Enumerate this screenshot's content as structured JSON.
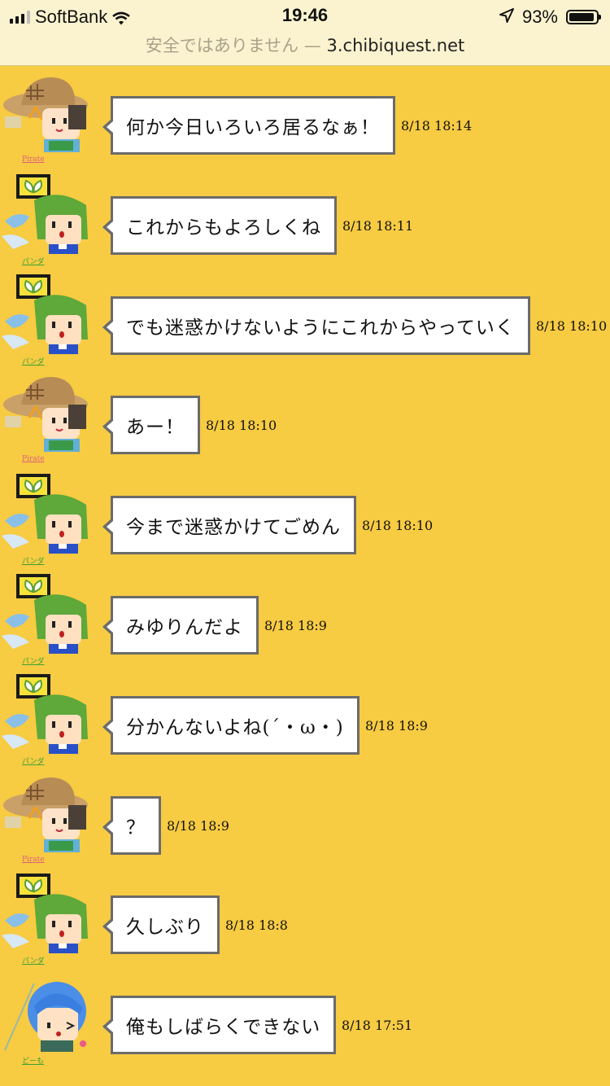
{
  "status_bar": {
    "carrier": "SoftBank",
    "time": "19:46",
    "battery_percent_text": "93%",
    "battery_level": 0.93,
    "url_warning": "安全ではありません —",
    "url_host": "3.chibiquest.net"
  },
  "colors": {
    "background": "#f7cb42",
    "bubble_border": "#6b6b6b",
    "name_pirate": "#e0607a",
    "name_panda": "#3aa335",
    "name_dome": "#3aa335"
  },
  "messages": [
    {
      "avatar": "straw-hat-character-icon",
      "text": "何か今日いろいろ居るなぁ！",
      "time": "8/18 18:14",
      "name": "Pirate"
    },
    {
      "avatar": "green-hair-character-icon",
      "text": "これからもよろしくね",
      "time": "8/18 18:11",
      "name": "パンダ"
    },
    {
      "avatar": "green-hair-character-icon",
      "text": "でも迷惑かけないようにこれからやっていく",
      "time": "8/18 18:10",
      "name": "パンダ"
    },
    {
      "avatar": "straw-hat-character-icon",
      "text": "あー！",
      "time": "8/18 18:10",
      "name": "Pirate"
    },
    {
      "avatar": "green-hair-character-icon",
      "text": "今まで迷惑かけてごめん",
      "time": "8/18 18:10",
      "name": "パンダ"
    },
    {
      "avatar": "green-hair-character-icon",
      "text": "みゆりんだよ",
      "time": "8/18 18:9",
      "name": "パンダ"
    },
    {
      "avatar": "green-hair-character-icon",
      "text": "分かんないよね(´・ω・)",
      "time": "8/18 18:9",
      "name": "パンダ"
    },
    {
      "avatar": "straw-hat-character-icon",
      "text": "？",
      "time": "8/18 18:9",
      "name": "Pirate"
    },
    {
      "avatar": "green-hair-character-icon",
      "text": "久しぶり",
      "time": "8/18 18:8",
      "name": "パンダ"
    },
    {
      "avatar": "blue-hair-character-icon",
      "text": "俺もしばらくできない",
      "time": "8/18 17:51",
      "name": "どーも"
    }
  ]
}
